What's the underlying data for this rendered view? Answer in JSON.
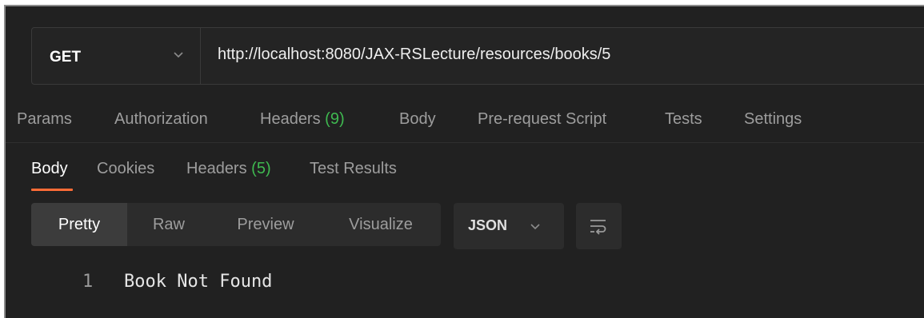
{
  "request": {
    "method": "GET",
    "url": "http://localhost:8080/JAX-RSLecture/resources/books/5"
  },
  "request_tabs": {
    "params": "Params",
    "authorization": "Authorization",
    "headers_label": "Headers",
    "headers_count": "(9)",
    "body": "Body",
    "pre_request": "Pre-request Script",
    "tests": "Tests",
    "settings": "Settings"
  },
  "response_tabs": {
    "body": "Body",
    "cookies": "Cookies",
    "headers_label": "Headers",
    "headers_count": "(5)",
    "test_results": "Test Results"
  },
  "view_modes": {
    "pretty": "Pretty",
    "raw": "Raw",
    "preview": "Preview",
    "visualize": "Visualize"
  },
  "format": {
    "selected": "JSON"
  },
  "response_body": {
    "lines": [
      {
        "number": "1",
        "text": "Book Not Found"
      }
    ]
  },
  "colors": {
    "background": "#212121",
    "accent": "#ff6c37",
    "count_green": "#3fb950"
  },
  "icons": {
    "method_dropdown": "chevron-down-icon",
    "format_dropdown": "chevron-down-icon",
    "wrap": "wrap-lines-icon"
  }
}
